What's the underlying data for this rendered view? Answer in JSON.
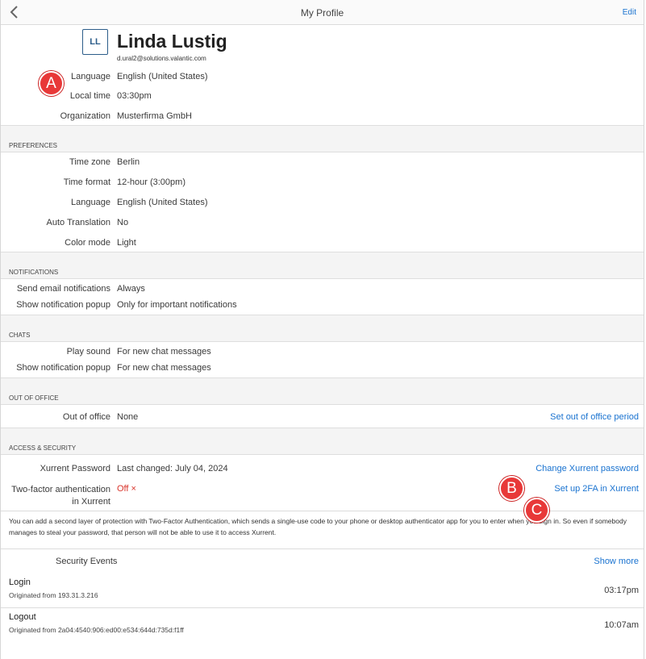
{
  "header": {
    "title": "My Profile",
    "edit_label": "Edit"
  },
  "profile": {
    "initials": "LL",
    "name": "Linda Lustig",
    "email": "d.ural2@solutions.valantic.com",
    "fields": [
      {
        "label": "Language",
        "value": "English (United States)"
      },
      {
        "label": "Local time",
        "value": "03:30pm"
      },
      {
        "label": "Organization",
        "value": "Musterfirma GmbH"
      }
    ]
  },
  "preferences": {
    "title": "PREFERENCES",
    "fields": [
      {
        "label": "Time zone",
        "value": "Berlin"
      },
      {
        "label": "Time format",
        "value": "12-hour (3:00pm)"
      },
      {
        "label": "Language",
        "value": "English (United States)"
      },
      {
        "label": "Auto Translation",
        "value": "No"
      },
      {
        "label": "Color mode",
        "value": "Light"
      }
    ]
  },
  "notifications": {
    "title": "NOTIFICATIONS",
    "fields": [
      {
        "label": "Send email notifications",
        "value": "Always"
      },
      {
        "label": "Show notification popup",
        "value": "Only for important notifications"
      }
    ]
  },
  "chats": {
    "title": "CHATS",
    "fields": [
      {
        "label": "Play sound",
        "value": "For new chat messages"
      },
      {
        "label": "Show notification popup",
        "value": "For new chat messages"
      }
    ]
  },
  "out_of_office": {
    "title": "OUT OF OFFICE",
    "label": "Out of office",
    "value": "None",
    "action": "Set out of office period"
  },
  "security": {
    "title": "ACCESS & SECURITY",
    "password_label": "Xurrent Password",
    "password_value": "Last changed: July 04, 2024",
    "password_action": "Change Xurrent password",
    "twofa_label_line1": "Two-factor authentication",
    "twofa_label_line2": "in Xurrent",
    "twofa_value": "Off ×",
    "twofa_action": "Set up 2FA in Xurrent",
    "description": "You can add a second layer of protection with Two-Factor Authentication, which sends a single-use code to your phone or desktop authenticator app for you to enter when you sign in. So even if somebody manages to steal your password, that person will not be able to use it to access Xurrent."
  },
  "events": {
    "title": "Security Events",
    "show_more": "Show more",
    "items": [
      {
        "title": "Login",
        "sub": "Originated from 193.31.3.216",
        "time": "03:17pm"
      },
      {
        "title": "Logout",
        "sub": "Originated from 2a04:4540:906:ed00:e534:644d:735d:f1ff",
        "time": "10:07am"
      }
    ]
  },
  "markers": {
    "a": "A",
    "b": "B",
    "c": "C"
  },
  "colors": {
    "link": "#1a73d0",
    "marker": "#e83838",
    "off": "#d9342b"
  }
}
